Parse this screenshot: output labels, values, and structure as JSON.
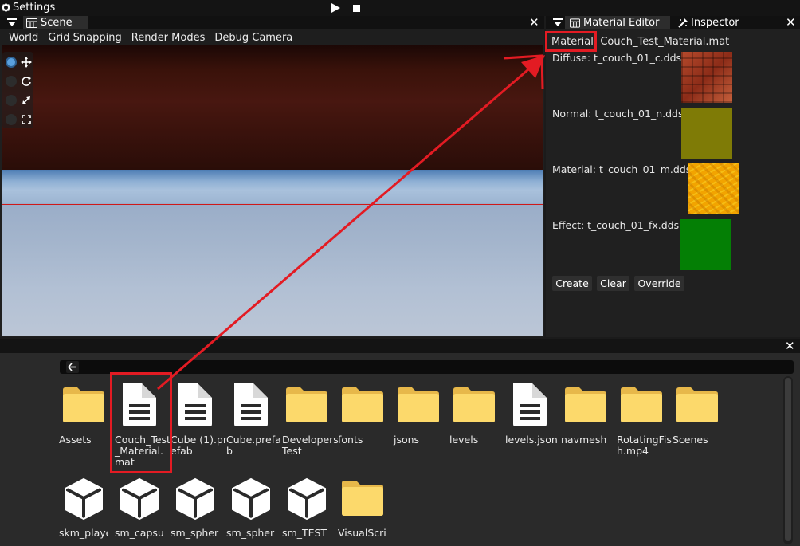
{
  "topbar": {
    "settings_label": "Settings",
    "icons": [
      "gear-icon",
      "play-icon",
      "stop-icon"
    ]
  },
  "scene_panel": {
    "tab_label": "Scene",
    "menu": [
      "World",
      "Grid Snapping",
      "Render Modes",
      "Debug Camera"
    ],
    "gizmo_tools": [
      "move-icon",
      "rotate-icon",
      "scale-icon",
      "rect-icon"
    ]
  },
  "right_panel": {
    "tabs": [
      {
        "label": "Material Editor",
        "icon": "material-editor-icon",
        "active": true
      },
      {
        "label": "Inspector",
        "icon": "inspector-icon",
        "active": false
      }
    ],
    "material_label": "Material:",
    "material_file": "Couch_Test_Material.mat",
    "textures": [
      {
        "label": "Diffuse: t_couch_01_c.dds",
        "color": "#b54a2c"
      },
      {
        "label": "Normal: t_couch_01_n.dds",
        "color": "#7f7b06"
      },
      {
        "label": "Material: t_couch_01_m.dds",
        "color": "#f2a400"
      },
      {
        "label": "Effect: t_couch_01_fx.dds",
        "color": "#047f05"
      }
    ],
    "buttons": [
      "Create",
      "Clear",
      "Override"
    ]
  },
  "asset_browser": {
    "items": [
      {
        "label": "Assets",
        "type": "folder"
      },
      {
        "label": "Couch_Test_Material.mat",
        "type": "file"
      },
      {
        "label": "Cube (1).prefab",
        "type": "file"
      },
      {
        "label": "Cube.prefab",
        "type": "file"
      },
      {
        "label": "DevelopersTest",
        "type": "folder"
      },
      {
        "label": "fonts",
        "type": "folder"
      },
      {
        "label": "jsons",
        "type": "folder"
      },
      {
        "label": "levels",
        "type": "folder"
      },
      {
        "label": "levels.json",
        "type": "file"
      },
      {
        "label": "navmesh",
        "type": "folder"
      },
      {
        "label": "RotatingFish.mp4",
        "type": "folder"
      },
      {
        "label": "Scenes",
        "type": "folder"
      },
      {
        "label": "skm_playe",
        "type": "model"
      },
      {
        "label": "sm_capsul",
        "type": "model"
      },
      {
        "label": "sm_spher",
        "type": "model"
      },
      {
        "label": "sm_spher",
        "type": "model"
      },
      {
        "label": "sm_TEST",
        "type": "model"
      },
      {
        "label": "VisualScri",
        "type": "folder"
      }
    ]
  },
  "colors": {
    "annotation": "#e31b23",
    "folder": "#fcd96b",
    "accent": "#5aa0de"
  }
}
